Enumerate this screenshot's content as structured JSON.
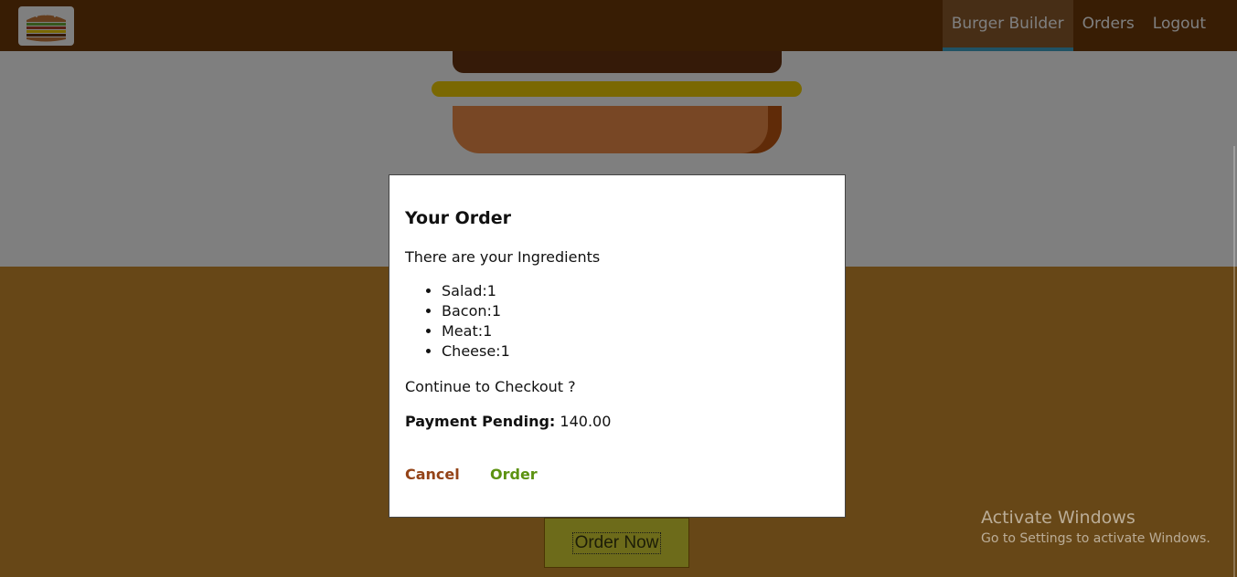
{
  "toolbar": {
    "logo_icon": "burger-logo-icon",
    "nav": [
      {
        "label": "Burger Builder",
        "active": true
      },
      {
        "label": "Orders",
        "active": false
      },
      {
        "label": "Logout",
        "active": false
      }
    ]
  },
  "build_controls": {
    "order_now_label": "Order Now"
  },
  "modal": {
    "title": "Your Order",
    "subtitle": "There are your Ingredients",
    "ingredients": [
      "Salad:1",
      "Bacon:1",
      "Meat:1",
      "Cheese:1"
    ],
    "continue_text": "Continue to Checkout ?",
    "payment_label": "Payment Pending:",
    "payment_value": "140.00",
    "cancel_label": "Cancel",
    "order_label": "Order"
  },
  "watermark": {
    "title": "Activate Windows",
    "subtitle": "Go to Settings to activate Windows."
  },
  "colors": {
    "toolbar": "#703B09",
    "controls_bg": "#CF8F2E",
    "cancel": "#944317",
    "order": "#5C9210",
    "active_tab_border": "#40A4C8"
  }
}
